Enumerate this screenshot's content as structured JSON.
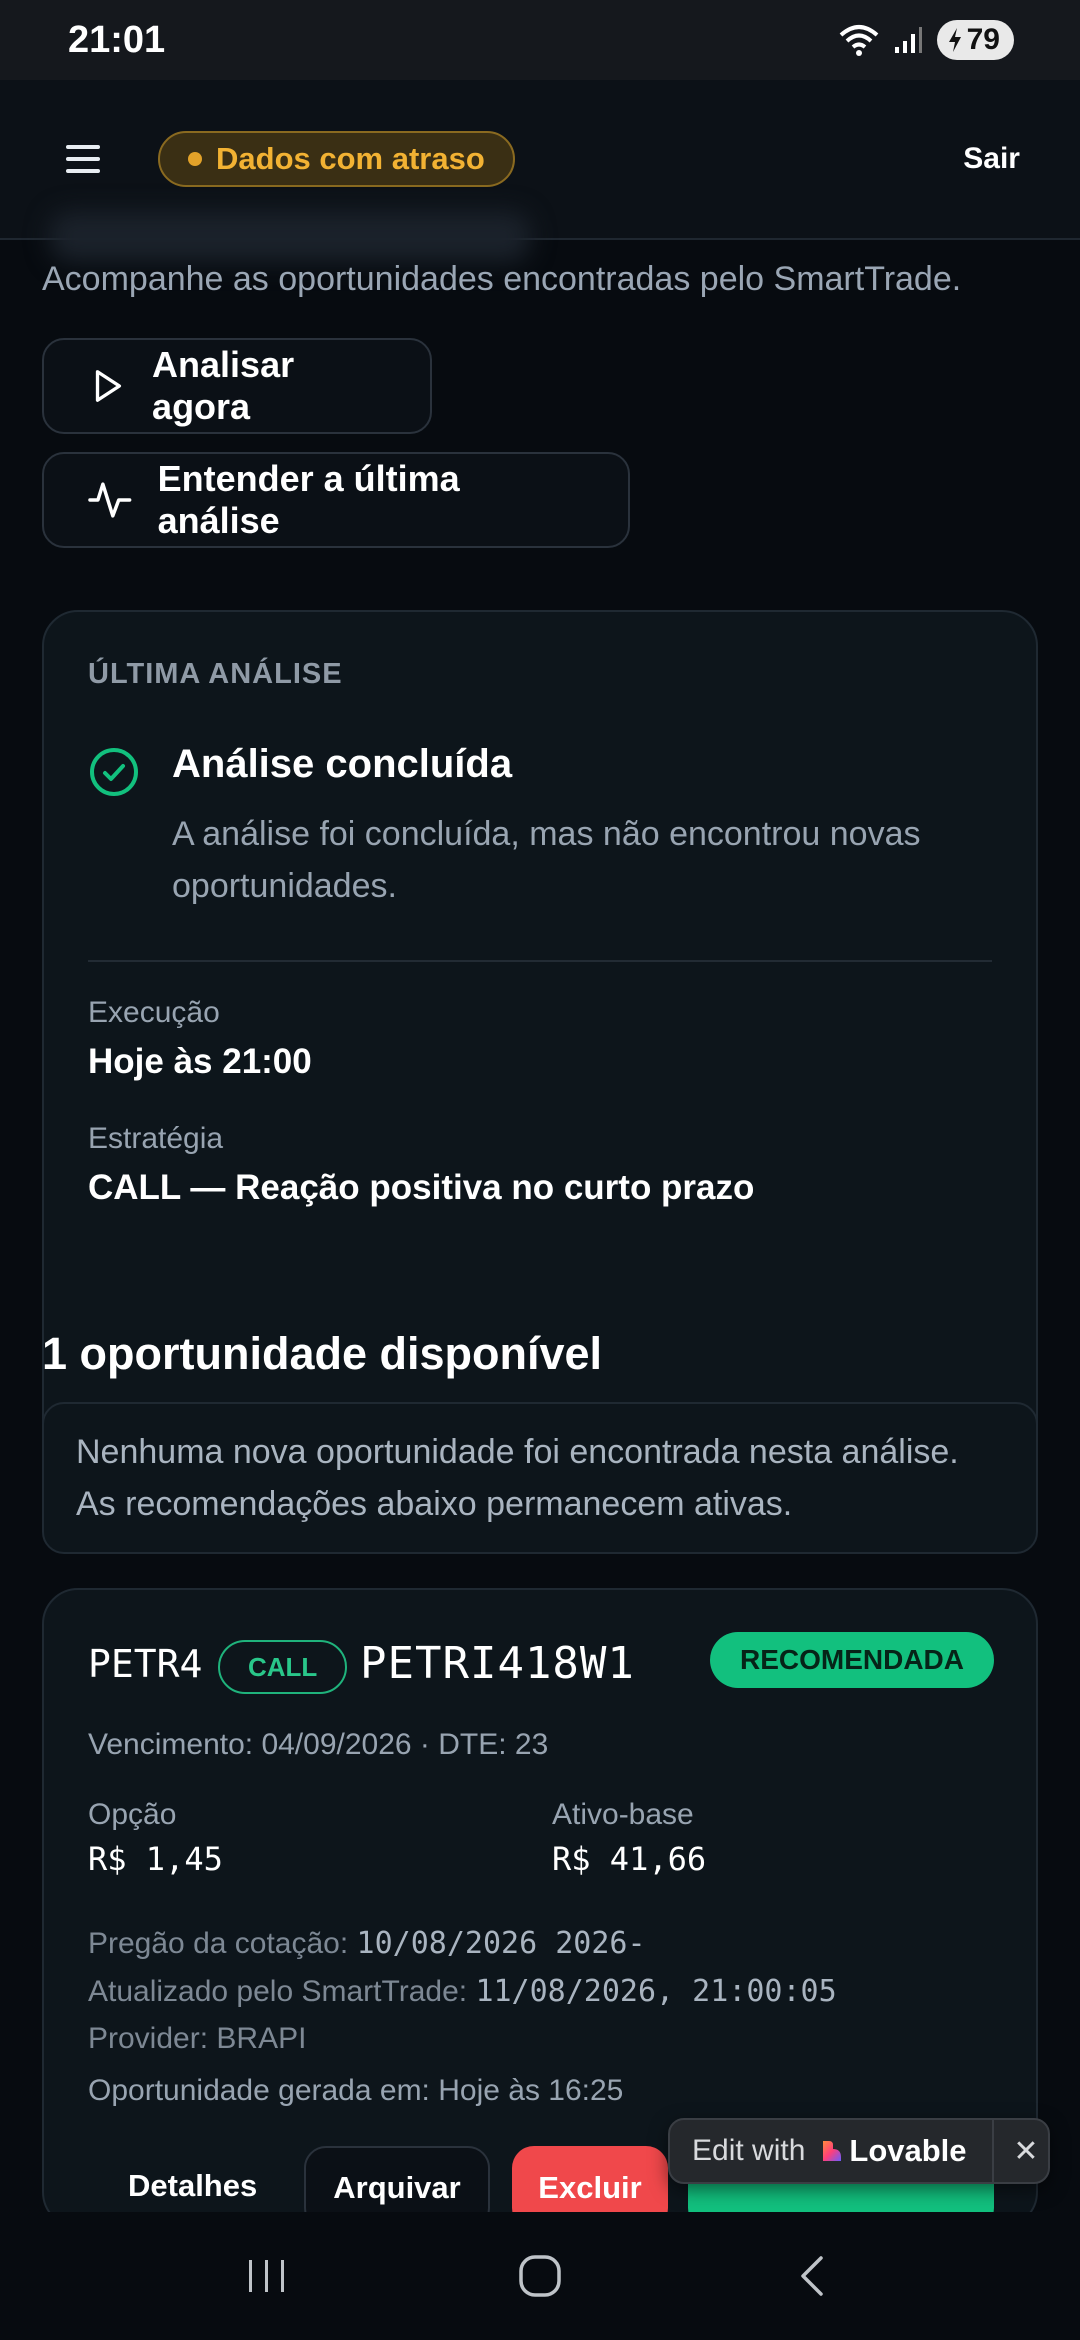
{
  "status_bar": {
    "time": "21:01",
    "battery": "79"
  },
  "header": {
    "delay_badge": "Dados com atraso",
    "logout": "Sair"
  },
  "page": {
    "subtitle": "Acompanhe as oportunidades encontradas pelo SmartTrade.",
    "analyze_button": "Analisar agora",
    "understand_button": "Entender a última análise"
  },
  "last_analysis": {
    "section_label": "ÚLTIMA ANÁLISE",
    "status_title": "Análise concluída",
    "status_description": "A análise foi concluída, mas não encontrou novas oportunidades.",
    "execution_label": "Execução",
    "execution_value": "Hoje às 21:00",
    "strategy_label": "Estratégia",
    "strategy_value": "CALL — Reação positiva no curto prazo"
  },
  "opportunities": {
    "title": "1 oportunidade disponível",
    "info": "Nenhuma nova oportunidade foi encontrada nesta análise. As recomendações abaixo permanecem ativas.",
    "card": {
      "ticker": "PETR4",
      "type": "CALL",
      "option_code": "PETRI418W1",
      "status": "RECOMENDADA",
      "expiry_line": "Vencimento: 04/09/2026 · DTE: 23",
      "option_label": "Opção",
      "option_value": "R$ 1,45",
      "underlying_label": "Ativo-base",
      "underlying_value": "R$ 41,66",
      "quote_session_label": "Pregão da cotação:",
      "quote_session_value": "10/08/2026 2026-",
      "updated_label": "Atualizado pelo SmartTrade:",
      "updated_value": "11/08/2026, 21:00:05",
      "provider_label": "Provider:",
      "provider_value": "BRAPI",
      "generated_line": "Oportunidade gerada em: Hoje às 16:25",
      "details_button": "Detalhes",
      "archive_button": "Arquivar",
      "delete_button": "Excluir"
    }
  },
  "overlay": {
    "edit_with": "Edit with",
    "brand": "Lovable"
  },
  "colors": {
    "accent_green": "#12c07e",
    "warning": "#f2b233",
    "danger": "#f0484b",
    "background": "#070b10"
  }
}
